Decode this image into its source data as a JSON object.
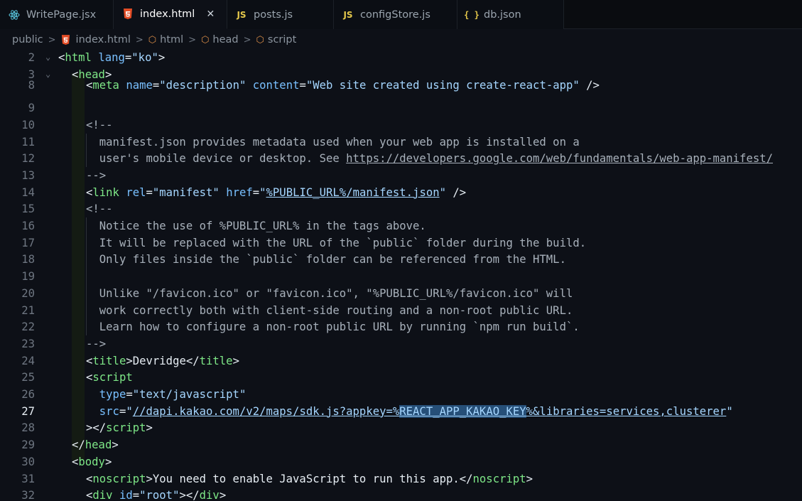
{
  "tabs": [
    {
      "label": "WritePage.jsx",
      "icon": "react-icon",
      "active": false
    },
    {
      "label": "index.html",
      "icon": "html5-icon",
      "active": true
    },
    {
      "label": "posts.js",
      "icon": "js-icon",
      "active": false
    },
    {
      "label": "configStore.js",
      "icon": "js-icon",
      "active": false
    },
    {
      "label": "db.json",
      "icon": "json-icon",
      "active": false
    }
  ],
  "breadcrumb": [
    "public",
    "index.html",
    "html",
    "head",
    "script"
  ],
  "icons": {
    "js_label": "JS",
    "json_label": "{ }"
  },
  "colors": {
    "tag": "#7ee787",
    "attribute": "#79c0ff",
    "string": "#a5d6ff",
    "comment": "#a8b1bb",
    "background": "#0d1017"
  },
  "current_line": 27,
  "lines": [
    {
      "n": "2",
      "parts": [
        [
          "br",
          "<"
        ],
        [
          "tag",
          "html"
        ],
        [
          "text",
          " "
        ],
        [
          "attr",
          "lang"
        ],
        [
          "br",
          "="
        ],
        [
          "str",
          "\"ko\""
        ],
        [
          "br",
          ">"
        ]
      ]
    },
    {
      "n": "3",
      "parts": [
        [
          "br",
          "<"
        ],
        [
          "tag",
          "head"
        ],
        [
          "br",
          ">"
        ]
      ]
    },
    {
      "n": "8",
      "parts": [
        [
          "br",
          "<"
        ],
        [
          "tag",
          "meta"
        ],
        [
          "text",
          " "
        ],
        [
          "attr",
          "name"
        ],
        [
          "br",
          "="
        ],
        [
          "str",
          "\"description\""
        ],
        [
          "text",
          " "
        ],
        [
          "attr",
          "content"
        ],
        [
          "br",
          "="
        ],
        [
          "str",
          "\"Web site created using create-react-app\""
        ],
        [
          "text",
          " "
        ],
        [
          "br",
          "/>"
        ]
      ]
    },
    {
      "n": "9",
      "parts": []
    },
    {
      "n": "10",
      "parts": [
        [
          "cmt",
          "<!--"
        ]
      ]
    },
    {
      "n": "11",
      "parts": [
        [
          "cmt",
          "  manifest.json provides metadata used when your web app is installed on a"
        ]
      ]
    },
    {
      "n": "12",
      "parts": [
        [
          "cmt",
          "  user's mobile device or desktop. See "
        ],
        [
          "link",
          "https://developers.google.com/web/fundamentals/web-app-manifest/"
        ]
      ]
    },
    {
      "n": "13",
      "parts": [
        [
          "cmt",
          "-->"
        ]
      ]
    },
    {
      "n": "14",
      "parts": [
        [
          "br",
          "<"
        ],
        [
          "tag",
          "link"
        ],
        [
          "text",
          " "
        ],
        [
          "attr",
          "rel"
        ],
        [
          "br",
          "="
        ],
        [
          "str",
          "\"manifest\""
        ],
        [
          "text",
          " "
        ],
        [
          "attr",
          "href"
        ],
        [
          "br",
          "="
        ],
        [
          "str",
          "\""
        ],
        [
          "strlink",
          "%PUBLIC_URL%/manifest.json"
        ],
        [
          "str",
          "\""
        ],
        [
          "text",
          " "
        ],
        [
          "br",
          "/>"
        ]
      ]
    },
    {
      "n": "15",
      "parts": [
        [
          "cmt",
          "<!--"
        ]
      ]
    },
    {
      "n": "16",
      "parts": [
        [
          "cmt",
          "  Notice the use of %PUBLIC_URL% in the tags above."
        ]
      ]
    },
    {
      "n": "17",
      "parts": [
        [
          "cmt",
          "  It will be replaced with the URL of the `public` folder during the build."
        ]
      ]
    },
    {
      "n": "18",
      "parts": [
        [
          "cmt",
          "  Only files inside the `public` folder can be referenced from the HTML."
        ]
      ]
    },
    {
      "n": "19",
      "parts": []
    },
    {
      "n": "20",
      "parts": [
        [
          "cmt",
          "  Unlike \"/favicon.ico\" or \"favicon.ico\", \"%PUBLIC_URL%/favicon.ico\" will"
        ]
      ]
    },
    {
      "n": "21",
      "parts": [
        [
          "cmt",
          "  work correctly both with client-side routing and a non-root public URL."
        ]
      ]
    },
    {
      "n": "22",
      "parts": [
        [
          "cmt",
          "  Learn how to configure a non-root public URL by running `npm run build`."
        ]
      ]
    },
    {
      "n": "23",
      "parts": [
        [
          "cmt",
          "-->"
        ]
      ]
    },
    {
      "n": "24",
      "parts": [
        [
          "br",
          "<"
        ],
        [
          "tag",
          "title"
        ],
        [
          "br",
          ">"
        ],
        [
          "text",
          "Devridge"
        ],
        [
          "br",
          "</"
        ],
        [
          "tag",
          "title"
        ],
        [
          "br",
          ">"
        ]
      ]
    },
    {
      "n": "25",
      "parts": [
        [
          "br",
          "<"
        ],
        [
          "tag",
          "script"
        ]
      ]
    },
    {
      "n": "26",
      "parts": [
        [
          "text",
          "  "
        ],
        [
          "attr",
          "type"
        ],
        [
          "br",
          "="
        ],
        [
          "str",
          "\"text/javascript\""
        ]
      ]
    },
    {
      "n": "27",
      "parts": [
        [
          "text",
          "  "
        ],
        [
          "attr",
          "src"
        ],
        [
          "br",
          "="
        ],
        [
          "str",
          "\""
        ],
        [
          "strlink",
          "//dapi.kakao.com/v2/maps/sdk.js?appkey=%"
        ],
        [
          "strlinksel",
          "REACT_APP_KAKAO_KEY"
        ],
        [
          "strlink",
          "%&libraries=services,clusterer"
        ],
        [
          "str",
          "\""
        ]
      ]
    },
    {
      "n": "28",
      "parts": [
        [
          "br",
          "></"
        ],
        [
          "tag",
          "script"
        ],
        [
          "br",
          ">"
        ]
      ]
    },
    {
      "n": "29",
      "parts": [
        [
          "br",
          "</"
        ],
        [
          "tag",
          "head"
        ],
        [
          "br",
          ">"
        ]
      ]
    },
    {
      "n": "30",
      "parts": [
        [
          "br",
          "<"
        ],
        [
          "tag",
          "body"
        ],
        [
          "br",
          ">"
        ]
      ]
    },
    {
      "n": "31",
      "parts": [
        [
          "br",
          "<"
        ],
        [
          "tag",
          "noscript"
        ],
        [
          "br",
          ">"
        ],
        [
          "text",
          "You need to enable JavaScript to run this app."
        ],
        [
          "br",
          "</"
        ],
        [
          "tag",
          "noscript"
        ],
        [
          "br",
          ">"
        ]
      ]
    },
    {
      "n": "32",
      "parts": [
        [
          "br",
          "<"
        ],
        [
          "tag",
          "div"
        ],
        [
          "text",
          " "
        ],
        [
          "attr",
          "id"
        ],
        [
          "br",
          "="
        ],
        [
          "str",
          "\"root\""
        ],
        [
          "br",
          "></"
        ],
        [
          "tag",
          "div"
        ],
        [
          "br",
          ">"
        ]
      ]
    }
  ]
}
